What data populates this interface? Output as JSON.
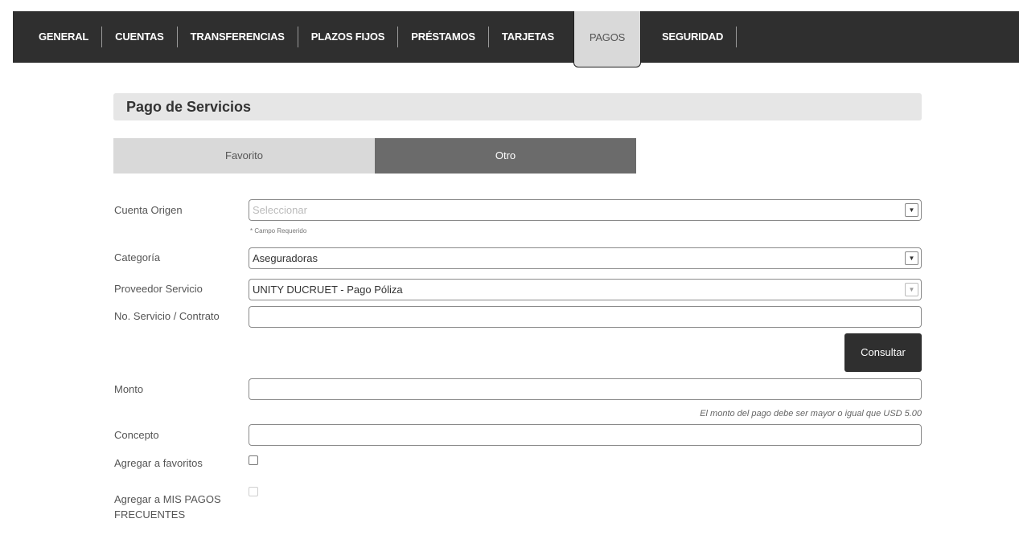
{
  "nav": {
    "items": [
      "GENERAL",
      "CUENTAS",
      "TRANSFERENCIAS",
      "PLAZOS FIJOS",
      "PRÉSTAMOS",
      "TARJETAS",
      "PAGOS",
      "SEGURIDAD"
    ],
    "active": "PAGOS"
  },
  "section": {
    "title": "Pago de Servicios"
  },
  "toggle": {
    "favorito": "Favorito",
    "otro": "Otro",
    "selected": "Otro"
  },
  "form": {
    "cuenta_origen": {
      "label": "Cuenta Origen",
      "placeholder": "Seleccionar",
      "hint": "* Campo Requerido"
    },
    "categoria": {
      "label": "Categoría",
      "value": "Aseguradoras"
    },
    "proveedor": {
      "label": "Proveedor Servicio",
      "value": "UNITY DUCRUET - Pago Póliza"
    },
    "no_servicio": {
      "label": "No. Servicio / Contrato",
      "value": ""
    },
    "consultar_label": "Consultar",
    "monto": {
      "label": "Monto",
      "value": "",
      "note": "El monto del pago debe ser mayor o igual que USD 5.00"
    },
    "concepto": {
      "label": "Concepto",
      "value": ""
    },
    "agregar_favoritos": {
      "label": "Agregar a favoritos",
      "checked": false
    },
    "mis_pagos": {
      "label_line1": "Agregar a MIS PAGOS",
      "label_line2": "FRECUENTES",
      "checked": false,
      "disabled": true
    }
  },
  "icons": {
    "caret": "caret-down-icon"
  },
  "colors": {
    "nav_bg": "#2f2f2f",
    "active_tab": "#d9d9d9",
    "otro_bg": "#6b6b6b",
    "button_bg": "#2f2f2f"
  }
}
